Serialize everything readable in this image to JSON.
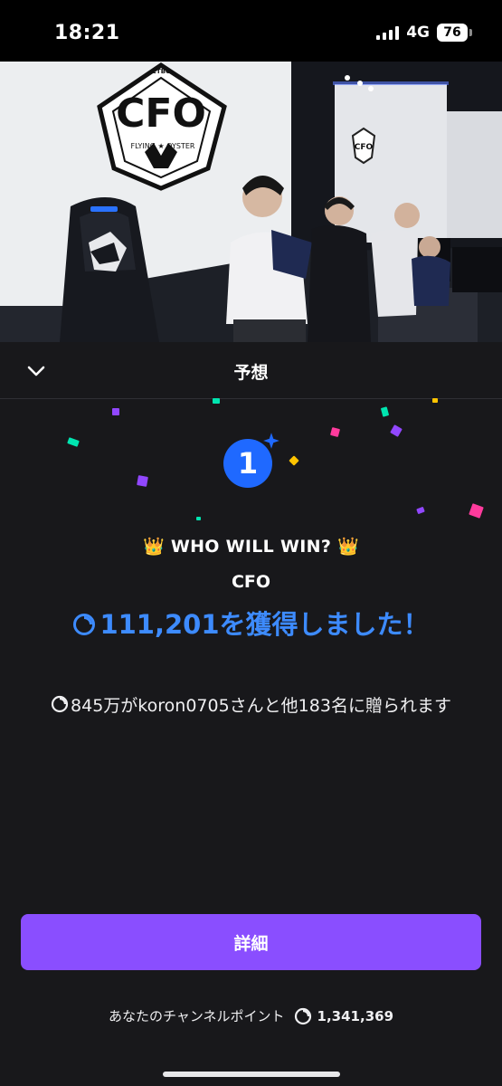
{
  "status_bar": {
    "time": "18:21",
    "network": "4G",
    "battery": "76"
  },
  "stream": {
    "logo_top": "CTBC",
    "logo_main": "CFO",
    "logo_bottom": "FLYING ★ OYSTER",
    "screen_logo": "CFO"
  },
  "prediction": {
    "header_title": "予想",
    "rank": "1",
    "question": "👑 WHO WILL WIN? 👑",
    "outcome": "CFO",
    "won_text": "111,201を獲得しました！",
    "distribution_text": "845万がkoron0705さんと他183名に贈られます",
    "details_label": "詳細",
    "balance_label": "あなたのチャンネルポイント",
    "balance_value": "1,341,369"
  },
  "colors": {
    "accent_purple": "#8a4eff",
    "win_blue": "#3d8bff",
    "badge_blue": "#1f69ff",
    "panel_bg": "#18181b"
  },
  "icons": [
    "chevron-down-icon",
    "rank-sparkle-icon",
    "channel-points-icon"
  ]
}
